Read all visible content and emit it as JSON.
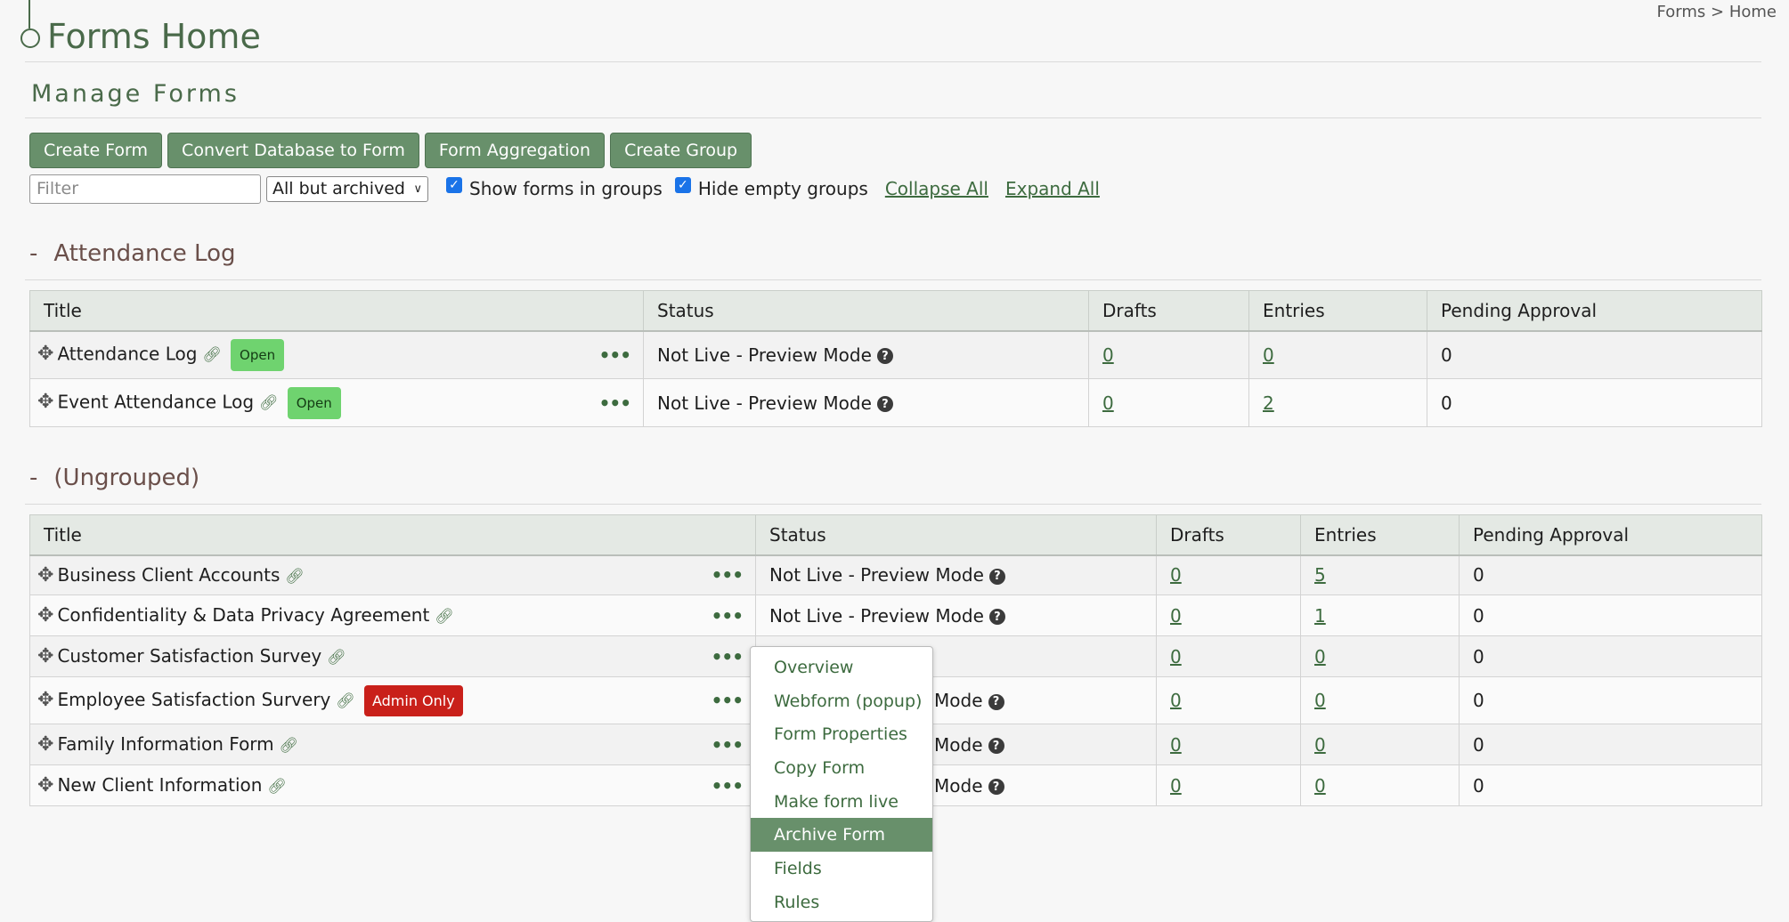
{
  "header": {
    "title": "Forms Home",
    "breadcrumb": [
      "Forms",
      ">",
      "Home"
    ],
    "subtitle": "Manage Forms"
  },
  "toolbar": {
    "buttons": [
      "Create Form",
      "Convert Database to Form",
      "Form Aggregation",
      "Create Group"
    ]
  },
  "filters": {
    "filter_placeholder": "Filter",
    "filter_value": "",
    "status_select": "All but archived",
    "show_in_groups_label": "Show forms in groups",
    "show_in_groups_checked": true,
    "hide_empty_label": "Hide empty groups",
    "hide_empty_checked": true,
    "collapse_all": "Collapse All",
    "expand_all": "Expand All"
  },
  "columns": [
    "Title",
    "Status",
    "Drafts",
    "Entries",
    "Pending Approval"
  ],
  "groups": [
    {
      "toggle": "-",
      "name": "Attendance Log",
      "rows": [
        {
          "title": "Attendance Log",
          "badge": "Open",
          "status": "Not Live - Preview Mode",
          "drafts": "0",
          "entries": "0",
          "pending": "0"
        },
        {
          "title": "Event Attendance Log",
          "badge": "Open",
          "status": "Not Live - Preview Mode",
          "drafts": "0",
          "entries": "2",
          "pending": "0"
        }
      ]
    },
    {
      "toggle": "-",
      "name": "(Ungrouped)",
      "rows": [
        {
          "title": "Business Client Accounts",
          "badge": "",
          "status": "Not Live - Preview Mode",
          "drafts": "0",
          "entries": "5",
          "pending": "0"
        },
        {
          "title": "Confidentiality & Data Privacy Agreement",
          "badge": "",
          "status": "Not Live - Preview Mode",
          "drafts": "0",
          "entries": "1",
          "pending": "0"
        },
        {
          "title": "Customer Satisfaction Survey",
          "badge": "",
          "status": "",
          "drafts": "0",
          "entries": "0",
          "pending": "0"
        },
        {
          "title": "Employee Satisfaction Survery",
          "badge": "Admin Only",
          "status": "Mode",
          "drafts": "0",
          "entries": "0",
          "pending": "0"
        },
        {
          "title": "Family Information Form",
          "badge": "",
          "status": "Mode",
          "drafts": "0",
          "entries": "0",
          "pending": "0"
        },
        {
          "title": "New Client Information",
          "badge": "",
          "status": "Mode",
          "drafts": "0",
          "entries": "0",
          "pending": "0"
        }
      ]
    }
  ],
  "context_menu": {
    "items": [
      "Overview",
      "Webform (popup)",
      "Form Properties",
      "Copy Form",
      "Make form live",
      "Archive Form",
      "Fields",
      "Rules"
    ],
    "highlighted": "Archive Form"
  },
  "colors": {
    "brand_green": "#68906b",
    "link_green": "#3d6b3f",
    "badge_open": "#6fd36f",
    "badge_admin": "#c9201a"
  }
}
